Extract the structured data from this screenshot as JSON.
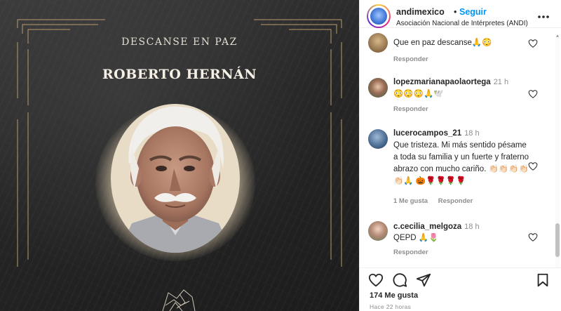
{
  "post": {
    "heading": "DESCANSE EN PAZ",
    "name": "ROBERTO HERNÁN"
  },
  "header": {
    "username": "andimexico",
    "separator": "•",
    "follow_label": "Seguir",
    "subtitle": "Asociación Nacional de Intérpretes (ANDI)"
  },
  "comments": [
    {
      "username": "",
      "text": "Que en paz descanse🙏😳",
      "time": "",
      "reply_label": "Responder",
      "likes_label": ""
    },
    {
      "username": "lopezmarianapaolaortega",
      "text": "😳😳😳🙏🕊️",
      "time": "21 h",
      "reply_label": "Responder",
      "likes_label": ""
    },
    {
      "username": "lucerocampos_21",
      "text": "Que tristeza. Mi más sentido pésame a toda su familia y un fuerte y fraterno abrazo con mucho cariño. 👏🏻👏🏻👏🏻👏🏻👏🏻🙏 🎃🌹🌹🌹🌹",
      "time": "18 h",
      "reply_label": "Responder",
      "likes_label": "1 Me gusta"
    },
    {
      "username": "c.cecilia_melgoza",
      "text": "QEPD 🙏🌷",
      "time": "18 h",
      "reply_label": "Responder",
      "likes_label": ""
    }
  ],
  "footer": {
    "likes": "174 Me gusta",
    "time_ago": "Hace 22 horas"
  },
  "colors": {
    "link_blue": "#0095f6",
    "text_dark": "#262626",
    "text_muted": "#8e8e8e"
  }
}
